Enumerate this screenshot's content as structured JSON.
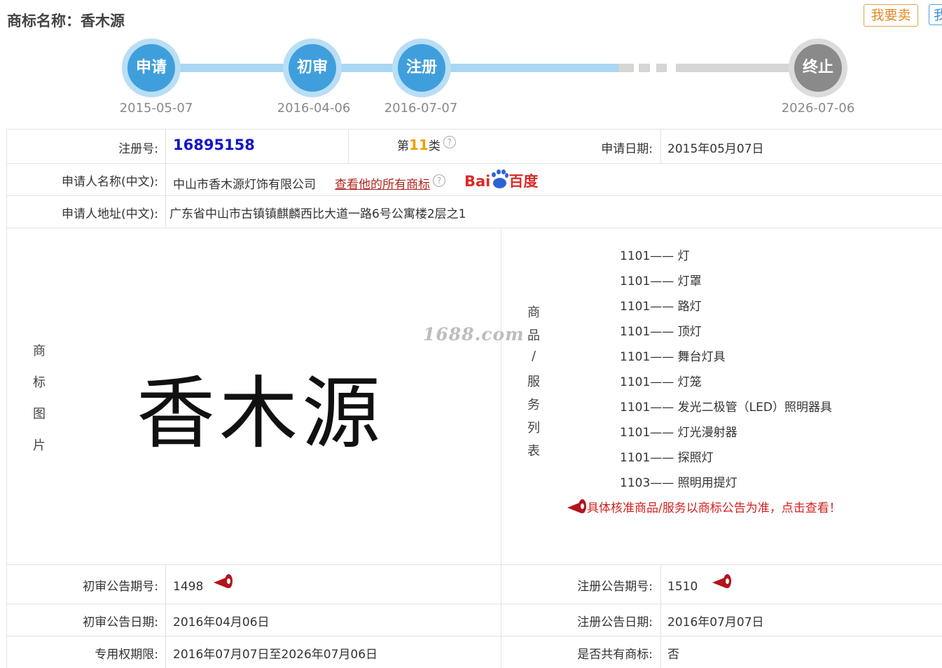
{
  "header": {
    "title_label": "商标名称：",
    "title_value": "香木源",
    "sell_button": "我要卖",
    "buy_button": "我"
  },
  "timeline": {
    "nodes": [
      {
        "label": "申请",
        "date": "2015-05-07",
        "status": "done"
      },
      {
        "label": "初审",
        "date": "2016-04-06",
        "status": "done"
      },
      {
        "label": "注册",
        "date": "2016-07-07",
        "status": "done"
      },
      {
        "label": "终止",
        "date": "2026-07-06",
        "status": "future"
      }
    ],
    "colors": {
      "done": "#3f9fdc",
      "future": "#8a8a8a"
    }
  },
  "details": {
    "reg_no_label": "注册号:",
    "reg_no": "16895158",
    "class_prefix": "第",
    "class_num": "11",
    "class_suffix": "类",
    "apply_date_label": "申请日期:",
    "apply_date": "2015年05月07日",
    "applicant_label": "申请人名称(中文):",
    "applicant": "中山市香木源灯饰有限公司",
    "all_marks_link": "查看他的所有商标",
    "baidu_text1": "Bai",
    "baidu_text2": "百度",
    "address_label": "申请人地址(中文):",
    "address": "广东省中山市古镇镇麒麟西比大道一路6号公寓楼2层之1",
    "image_label_chars": [
      "商",
      "标",
      "图",
      "片"
    ],
    "logo_text": "香木源",
    "watermark": "1688.com",
    "goods_label_chars": [
      "商",
      "品",
      "/",
      "服",
      "务",
      "列",
      "表"
    ],
    "goods": [
      {
        "code": "1101",
        "name": "灯"
      },
      {
        "code": "1101",
        "name": "灯罩"
      },
      {
        "code": "1101",
        "name": "路灯"
      },
      {
        "code": "1101",
        "name": "顶灯"
      },
      {
        "code": "1101",
        "name": "舞台灯具"
      },
      {
        "code": "1101",
        "name": "灯笼"
      },
      {
        "code": "1101",
        "name": "发光二极管（LED）照明器具"
      },
      {
        "code": "1101",
        "name": "灯光漫射器"
      },
      {
        "code": "1101",
        "name": "探照灯"
      },
      {
        "code": "1103",
        "name": "照明用提灯"
      }
    ],
    "goods_separator": "——",
    "notice": "具体核准商品/服务以商标公告为准，点击查看！",
    "prelim_no_label": "初审公告期号:",
    "prelim_no": "1498",
    "reg_pub_no_label": "注册公告期号:",
    "reg_pub_no": "1510",
    "prelim_date_label": "初审公告日期:",
    "prelim_date": "2016年04月06日",
    "reg_pub_date_label": "注册公告日期:",
    "reg_pub_date": "2016年07月07日",
    "exclusive_label": "专用权期限:",
    "exclusive_period": "2016年07月07日至2026年07月06日",
    "shared_label": "是否共有商标:",
    "shared": "否"
  }
}
